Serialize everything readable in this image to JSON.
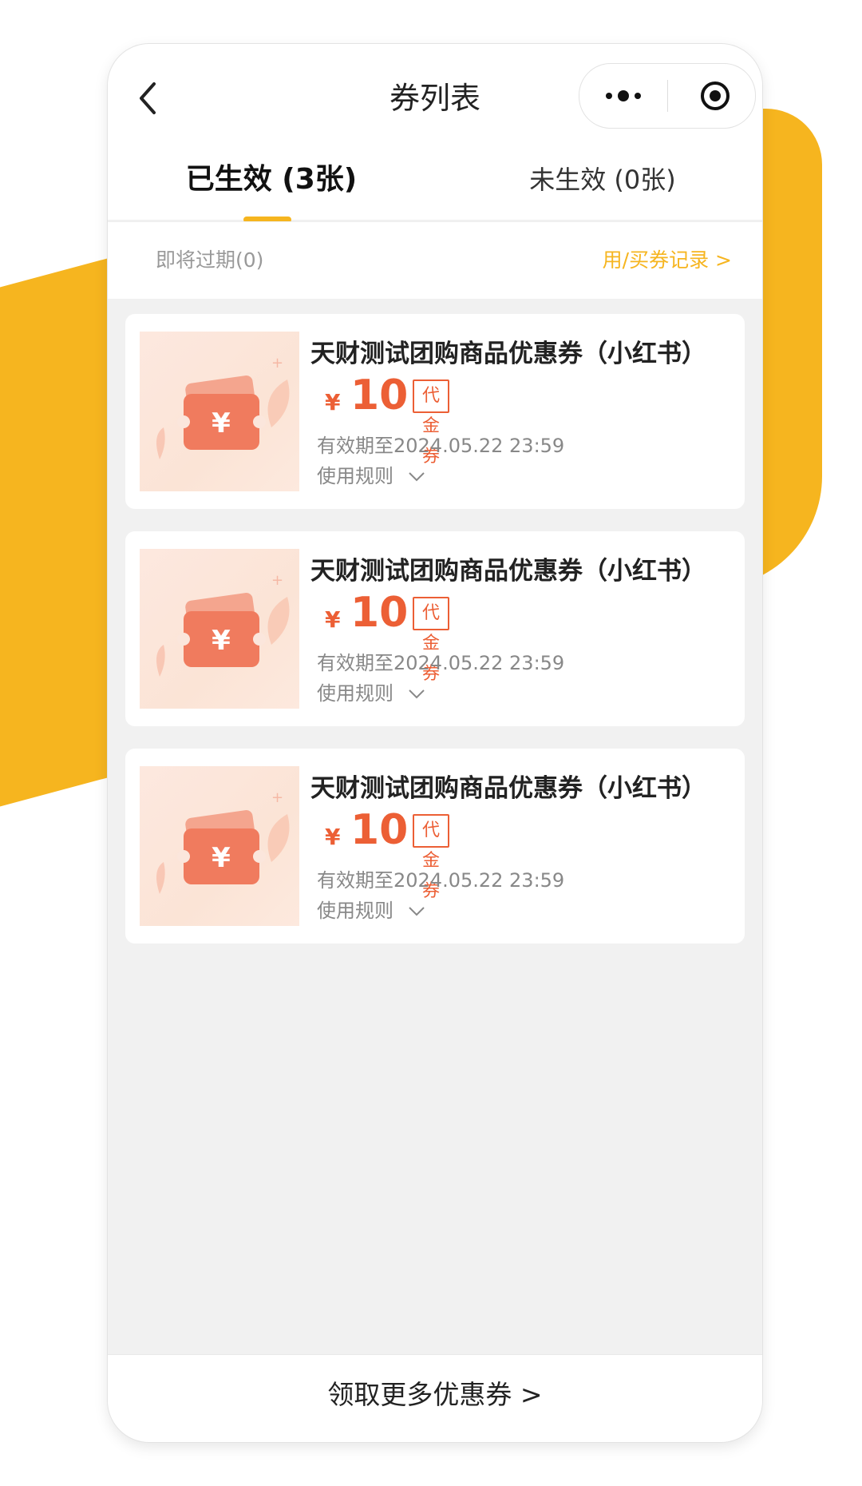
{
  "header": {
    "back_icon": "chevron-left-icon",
    "title": "券列表",
    "capsule": {
      "more_icon": "more-dots-icon",
      "more_text": "•●•",
      "target_icon": "target-icon"
    }
  },
  "tabs": [
    {
      "label": "已生效 (3张)",
      "active": true
    },
    {
      "label": "未生效 (0张)",
      "active": false
    }
  ],
  "subbar": {
    "expiring": "即将过期(0)",
    "records": "用/买券记录 >"
  },
  "coupons": [
    {
      "name": "天财测试团购商品优惠券（小红书）",
      "currency": "¥",
      "amount": "10",
      "type": "代金券",
      "validity": "有效期至2024.05.22 23:59",
      "rules": "使用规则",
      "thumb_icon": "coupon-wallet-icon"
    },
    {
      "name": "天财测试团购商品优惠券（小红书）",
      "currency": "¥",
      "amount": "10",
      "type": "代金券",
      "validity": "有效期至2024.05.22 23:59",
      "rules": "使用规则",
      "thumb_icon": "coupon-wallet-icon"
    },
    {
      "name": "天财测试团购商品优惠券（小红书）",
      "currency": "¥",
      "amount": "10",
      "type": "代金券",
      "validity": "有效期至2024.05.22 23:59",
      "rules": "使用规则",
      "thumb_icon": "coupon-wallet-icon"
    }
  ],
  "footer": {
    "more_coupons": "领取更多优惠券 >"
  },
  "colors": {
    "accent": "#F6B51F",
    "price": "#EC5F35",
    "text": "#222222",
    "muted": "#888888"
  }
}
